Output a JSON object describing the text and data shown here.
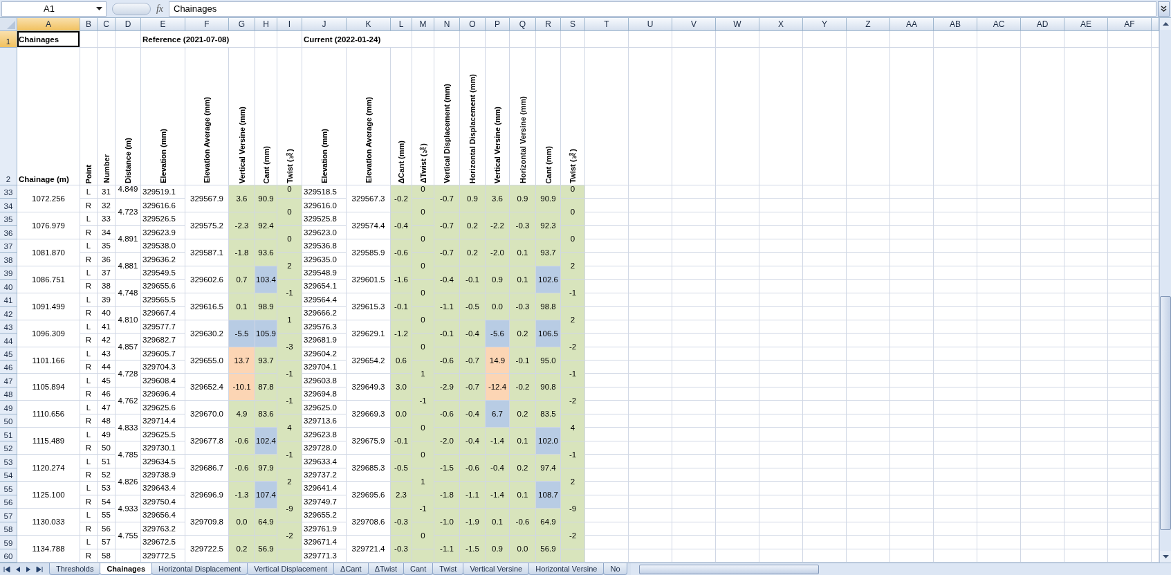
{
  "formula_bar": {
    "name_box": "A1",
    "function_label": "fx",
    "formula": "Chainages"
  },
  "columns": [
    {
      "label": "A",
      "selected": true,
      "shaded": false
    },
    {
      "label": "B",
      "selected": false,
      "shaded": false
    },
    {
      "label": "C",
      "selected": false,
      "shaded": false
    },
    {
      "label": "D",
      "selected": false,
      "shaded": false
    },
    {
      "label": "E",
      "selected": false,
      "shaded": false
    },
    {
      "label": "F",
      "selected": false,
      "shaded": false
    },
    {
      "label": "G",
      "selected": false,
      "shaded": true
    },
    {
      "label": "H",
      "selected": false,
      "shaded": true
    },
    {
      "label": "I",
      "selected": false,
      "shaded": true
    },
    {
      "label": "J",
      "selected": false,
      "shaded": false
    },
    {
      "label": "K",
      "selected": false,
      "shaded": false
    },
    {
      "label": "L",
      "selected": false,
      "shaded": true
    },
    {
      "label": "M",
      "selected": false,
      "shaded": true
    },
    {
      "label": "N",
      "selected": false,
      "shaded": true
    },
    {
      "label": "O",
      "selected": false,
      "shaded": true
    },
    {
      "label": "P",
      "selected": false,
      "shaded": true
    },
    {
      "label": "Q",
      "selected": false,
      "shaded": true
    },
    {
      "label": "R",
      "selected": false,
      "shaded": true
    },
    {
      "label": "S",
      "selected": false,
      "shaded": true
    },
    {
      "label": "T",
      "selected": false,
      "shaded": false
    },
    {
      "label": "U",
      "selected": false,
      "shaded": false
    },
    {
      "label": "V",
      "selected": false,
      "shaded": false
    },
    {
      "label": "W",
      "selected": false,
      "shaded": false
    },
    {
      "label": "X",
      "selected": false,
      "shaded": false
    },
    {
      "label": "Y",
      "selected": false,
      "shaded": false
    },
    {
      "label": "Z",
      "selected": false,
      "shaded": false
    },
    {
      "label": "AA",
      "selected": false,
      "shaded": false
    },
    {
      "label": "AB",
      "selected": false,
      "shaded": false
    },
    {
      "label": "AC",
      "selected": false,
      "shaded": false
    },
    {
      "label": "AD",
      "selected": false,
      "shaded": false
    },
    {
      "label": "AE",
      "selected": false,
      "shaded": false
    },
    {
      "label": "AF",
      "selected": false,
      "shaded": false
    }
  ],
  "rows": [
    {
      "label": "1",
      "selected": true
    },
    {
      "label": "2",
      "selected": false
    },
    {
      "label": "33",
      "selected": false
    },
    {
      "label": "34",
      "selected": false
    },
    {
      "label": "35",
      "selected": false
    },
    {
      "label": "36",
      "selected": false
    },
    {
      "label": "37",
      "selected": false
    },
    {
      "label": "38",
      "selected": false
    },
    {
      "label": "39",
      "selected": false
    },
    {
      "label": "40",
      "selected": false
    },
    {
      "label": "41",
      "selected": false
    },
    {
      "label": "42",
      "selected": false
    },
    {
      "label": "43",
      "selected": false
    },
    {
      "label": "44",
      "selected": false
    },
    {
      "label": "45",
      "selected": false
    },
    {
      "label": "46",
      "selected": false
    },
    {
      "label": "47",
      "selected": false
    },
    {
      "label": "48",
      "selected": false
    },
    {
      "label": "49",
      "selected": false
    },
    {
      "label": "50",
      "selected": false
    },
    {
      "label": "51",
      "selected": false
    },
    {
      "label": "52",
      "selected": false
    },
    {
      "label": "53",
      "selected": false
    },
    {
      "label": "54",
      "selected": false
    },
    {
      "label": "55",
      "selected": false
    },
    {
      "label": "56",
      "selected": false
    },
    {
      "label": "57",
      "selected": false
    },
    {
      "label": "58",
      "selected": false
    },
    {
      "label": "59",
      "selected": false
    },
    {
      "label": "60",
      "selected": false
    }
  ],
  "title_row": {
    "chainages": "Chainages",
    "reference": "Reference (2021-07-08)",
    "current": "Current (2022-01-24)"
  },
  "headers": [
    "Chainage (m)",
    "Point",
    "Number",
    "Distance (m)",
    "Elevation (mm)",
    "Elevation Average (mm)",
    "Vertical Versine (mm)",
    "Cant (mm)",
    "Twist (‰)",
    "Elevation (mm)",
    "Elevation Average (mm)",
    "ΔCant (mm)",
    "ΔTwist (‰)",
    "Vertical Displacement (mm)",
    "Horizontal Displacement (mm)",
    "Vertical Versine (mm)",
    "Horizontal Versine (mm)",
    "Cant (mm)",
    "Twist (‰)"
  ],
  "pairs": [
    {
      "chainage": "1072.256",
      "points": [
        {
          "side": "L",
          "number": "31",
          "ref_elevation": "329519.1",
          "cur_elevation": "329518.5"
        },
        {
          "side": "R",
          "number": "32",
          "ref_elevation": "329616.6",
          "cur_elevation": "329616.0"
        }
      ],
      "ref": {
        "average": "329567.9",
        "vertical_versine": {
          "text": "3.6"
        },
        "cant": {
          "text": "90.9"
        }
      },
      "cur": {
        "average": "329567.3",
        "delta_cant": "-0.2",
        "vertical_displacement": "-0.7",
        "horizontal_displacement": "0.9",
        "vertical_versine": {
          "text": "3.6"
        },
        "horizontal_versine": "0.9",
        "cant": {
          "text": "90.9"
        }
      }
    },
    {
      "chainage": "1076.979",
      "points": [
        {
          "side": "L",
          "number": "33",
          "ref_elevation": "329526.5",
          "cur_elevation": "329525.8"
        },
        {
          "side": "R",
          "number": "34",
          "ref_elevation": "329623.9",
          "cur_elevation": "329623.0"
        }
      ],
      "ref": {
        "average": "329575.2",
        "vertical_versine": {
          "text": "-2.3"
        },
        "cant": {
          "text": "92.4"
        }
      },
      "cur": {
        "average": "329574.4",
        "delta_cant": "-0.4",
        "vertical_displacement": "-0.7",
        "horizontal_displacement": "0.2",
        "vertical_versine": {
          "text": "-2.2"
        },
        "horizontal_versine": "-0.3",
        "cant": {
          "text": "92.3"
        }
      }
    },
    {
      "chainage": "1081.870",
      "points": [
        {
          "side": "L",
          "number": "35",
          "ref_elevation": "329538.0",
          "cur_elevation": "329536.8"
        },
        {
          "side": "R",
          "number": "36",
          "ref_elevation": "329636.2",
          "cur_elevation": "329635.0"
        }
      ],
      "ref": {
        "average": "329587.1",
        "vertical_versine": {
          "text": "-1.8"
        },
        "cant": {
          "text": "93.6"
        }
      },
      "cur": {
        "average": "329585.9",
        "delta_cant": "-0.6",
        "vertical_displacement": "-0.7",
        "horizontal_displacement": "0.2",
        "vertical_versine": {
          "text": "-2.0"
        },
        "horizontal_versine": "0.1",
        "cant": {
          "text": "93.7"
        }
      }
    },
    {
      "chainage": "1086.751",
      "points": [
        {
          "side": "L",
          "number": "37",
          "ref_elevation": "329549.5",
          "cur_elevation": "329548.9"
        },
        {
          "side": "R",
          "number": "38",
          "ref_elevation": "329655.6",
          "cur_elevation": "329654.1"
        }
      ],
      "ref": {
        "average": "329602.6",
        "vertical_versine": {
          "text": "0.7"
        },
        "cant": {
          "text": "103.4",
          "color": "#b8cce4"
        }
      },
      "cur": {
        "average": "329601.5",
        "delta_cant": "-1.6",
        "vertical_displacement": "-0.4",
        "horizontal_displacement": "-0.1",
        "vertical_versine": {
          "text": "0.9"
        },
        "horizontal_versine": "0.1",
        "cant": {
          "text": "102.6",
          "color": "#b8cce4"
        }
      }
    },
    {
      "chainage": "1091.499",
      "points": [
        {
          "side": "L",
          "number": "39",
          "ref_elevation": "329565.5",
          "cur_elevation": "329564.4"
        },
        {
          "side": "R",
          "number": "40",
          "ref_elevation": "329667.4",
          "cur_elevation": "329666.2"
        }
      ],
      "ref": {
        "average": "329616.5",
        "vertical_versine": {
          "text": "0.1"
        },
        "cant": {
          "text": "98.9"
        }
      },
      "cur": {
        "average": "329615.3",
        "delta_cant": "-0.1",
        "vertical_displacement": "-1.1",
        "horizontal_displacement": "-0.5",
        "vertical_versine": {
          "text": "0.0"
        },
        "horizontal_versine": "-0.3",
        "cant": {
          "text": "98.8"
        }
      }
    },
    {
      "chainage": "1096.309",
      "points": [
        {
          "side": "L",
          "number": "41",
          "ref_elevation": "329577.7",
          "cur_elevation": "329576.3"
        },
        {
          "side": "R",
          "number": "42",
          "ref_elevation": "329682.7",
          "cur_elevation": "329681.9"
        }
      ],
      "ref": {
        "average": "329630.2",
        "vertical_versine": {
          "text": "-5.5",
          "color": "#b8cce4"
        },
        "cant": {
          "text": "105.9",
          "color": "#b8cce4"
        }
      },
      "cur": {
        "average": "329629.1",
        "delta_cant": "-1.2",
        "vertical_displacement": "-0.1",
        "horizontal_displacement": "-0.4",
        "vertical_versine": {
          "text": "-5.6",
          "color": "#b8cce4"
        },
        "horizontal_versine": "0.2",
        "cant": {
          "text": "106.5",
          "color": "#b8cce4"
        }
      }
    },
    {
      "chainage": "1101.166",
      "points": [
        {
          "side": "L",
          "number": "43",
          "ref_elevation": "329605.7",
          "cur_elevation": "329604.2"
        },
        {
          "side": "R",
          "number": "44",
          "ref_elevation": "329704.3",
          "cur_elevation": "329704.1"
        }
      ],
      "ref": {
        "average": "329655.0",
        "vertical_versine": {
          "text": "13.7",
          "color": "#fcd5b4"
        },
        "cant": {
          "text": "93.7"
        }
      },
      "cur": {
        "average": "329654.2",
        "delta_cant": "0.6",
        "vertical_displacement": "-0.6",
        "horizontal_displacement": "-0.7",
        "vertical_versine": {
          "text": "14.9",
          "color": "#fcd5b4"
        },
        "horizontal_versine": "-0.1",
        "cant": {
          "text": "95.0"
        }
      }
    },
    {
      "chainage": "1105.894",
      "points": [
        {
          "side": "L",
          "number": "45",
          "ref_elevation": "329608.4",
          "cur_elevation": "329603.8"
        },
        {
          "side": "R",
          "number": "46",
          "ref_elevation": "329696.4",
          "cur_elevation": "329694.8"
        }
      ],
      "ref": {
        "average": "329652.4",
        "vertical_versine": {
          "text": "-10.1",
          "color": "#fcd5b4"
        },
        "cant": {
          "text": "87.8"
        }
      },
      "cur": {
        "average": "329649.3",
        "delta_cant": "3.0",
        "vertical_displacement": "-2.9",
        "horizontal_displacement": "-0.7",
        "vertical_versine": {
          "text": "-12.4",
          "color": "#fcd5b4"
        },
        "horizontal_versine": "-0.2",
        "cant": {
          "text": "90.8"
        }
      }
    },
    {
      "chainage": "1110.656",
      "points": [
        {
          "side": "L",
          "number": "47",
          "ref_elevation": "329625.6",
          "cur_elevation": "329625.0"
        },
        {
          "side": "R",
          "number": "48",
          "ref_elevation": "329714.4",
          "cur_elevation": "329713.6"
        }
      ],
      "ref": {
        "average": "329670.0",
        "vertical_versine": {
          "text": "4.9"
        },
        "cant": {
          "text": "83.6"
        }
      },
      "cur": {
        "average": "329669.3",
        "delta_cant": "0.0",
        "vertical_displacement": "-0.6",
        "horizontal_displacement": "-0.4",
        "vertical_versine": {
          "text": "6.7",
          "color": "#b8cce4"
        },
        "horizontal_versine": "0.2",
        "cant": {
          "text": "83.5"
        }
      }
    },
    {
      "chainage": "1115.489",
      "points": [
        {
          "side": "L",
          "number": "49",
          "ref_elevation": "329625.5",
          "cur_elevation": "329623.8"
        },
        {
          "side": "R",
          "number": "50",
          "ref_elevation": "329730.1",
          "cur_elevation": "329728.0"
        }
      ],
      "ref": {
        "average": "329677.8",
        "vertical_versine": {
          "text": "-0.6"
        },
        "cant": {
          "text": "102.4",
          "color": "#b8cce4"
        }
      },
      "cur": {
        "average": "329675.9",
        "delta_cant": "-0.1",
        "vertical_displacement": "-2.0",
        "horizontal_displacement": "-0.4",
        "vertical_versine": {
          "text": "-1.4"
        },
        "horizontal_versine": "0.1",
        "cant": {
          "text": "102.0",
          "color": "#b8cce4"
        }
      }
    },
    {
      "chainage": "1120.274",
      "points": [
        {
          "side": "L",
          "number": "51",
          "ref_elevation": "329634.5",
          "cur_elevation": "329633.4"
        },
        {
          "side": "R",
          "number": "52",
          "ref_elevation": "329738.9",
          "cur_elevation": "329737.2"
        }
      ],
      "ref": {
        "average": "329686.7",
        "vertical_versine": {
          "text": "-0.6"
        },
        "cant": {
          "text": "97.9"
        }
      },
      "cur": {
        "average": "329685.3",
        "delta_cant": "-0.5",
        "vertical_displacement": "-1.5",
        "horizontal_displacement": "-0.6",
        "vertical_versine": {
          "text": "-0.4"
        },
        "horizontal_versine": "0.2",
        "cant": {
          "text": "97.4"
        }
      }
    },
    {
      "chainage": "1125.100",
      "points": [
        {
          "side": "L",
          "number": "53",
          "ref_elevation": "329643.4",
          "cur_elevation": "329641.4"
        },
        {
          "side": "R",
          "number": "54",
          "ref_elevation": "329750.4",
          "cur_elevation": "329749.7"
        }
      ],
      "ref": {
        "average": "329696.9",
        "vertical_versine": {
          "text": "-1.3"
        },
        "cant": {
          "text": "107.4",
          "color": "#b8cce4"
        }
      },
      "cur": {
        "average": "329695.6",
        "delta_cant": "2.3",
        "vertical_displacement": "-1.8",
        "horizontal_displacement": "-1.1",
        "vertical_versine": {
          "text": "-1.4"
        },
        "horizontal_versine": "0.1",
        "cant": {
          "text": "108.7",
          "color": "#b8cce4"
        }
      }
    },
    {
      "chainage": "1130.033",
      "points": [
        {
          "side": "L",
          "number": "55",
          "ref_elevation": "329656.4",
          "cur_elevation": "329655.2"
        },
        {
          "side": "R",
          "number": "56",
          "ref_elevation": "329763.2",
          "cur_elevation": "329761.9"
        }
      ],
      "ref": {
        "average": "329709.8",
        "vertical_versine": {
          "text": "0.0"
        },
        "cant": {
          "text": "64.9"
        }
      },
      "cur": {
        "average": "329708.6",
        "delta_cant": "-0.3",
        "vertical_displacement": "-1.0",
        "horizontal_displacement": "-1.9",
        "vertical_versine": {
          "text": "0.1"
        },
        "horizontal_versine": "-0.6",
        "cant": {
          "text": "64.9"
        }
      }
    },
    {
      "chainage": "1134.788",
      "points": [
        {
          "side": "L",
          "number": "57",
          "ref_elevation": "329672.5",
          "cur_elevation": "329671.4"
        },
        {
          "side": "R",
          "number": "58",
          "ref_elevation": "329772.5",
          "cur_elevation": "329771.3"
        }
      ],
      "ref": {
        "average": "329722.5",
        "vertical_versine": {
          "text": "0.2"
        },
        "cant": {
          "text": "56.9"
        }
      },
      "cur": {
        "average": "329721.4",
        "delta_cant": "-0.3",
        "vertical_displacement": "-1.1",
        "horizontal_displacement": "-1.5",
        "vertical_versine": {
          "text": "0.9"
        },
        "horizontal_versine": "0.0",
        "cant": {
          "text": "56.9"
        }
      }
    }
  ],
  "offsets": [
    {
      "distance": "4.849",
      "ref_twist": "0",
      "delta_twist": "0",
      "twist": "0"
    },
    {
      "distance": "4.723",
      "ref_twist": "0",
      "delta_twist": "0",
      "twist": "0"
    },
    {
      "distance": "4.891",
      "ref_twist": "0",
      "delta_twist": "0",
      "twist": "0"
    },
    {
      "distance": "4.881",
      "ref_twist": "2",
      "delta_twist": "0",
      "twist": "2"
    },
    {
      "distance": "4.748",
      "ref_twist": "-1",
      "delta_twist": "0",
      "twist": "-1"
    },
    {
      "distance": "4.810",
      "ref_twist": "1",
      "delta_twist": "0",
      "twist": "2"
    },
    {
      "distance": "4.857",
      "ref_twist": "-3",
      "delta_twist": "0",
      "twist": "-2"
    },
    {
      "distance": "4.728",
      "ref_twist": "-1",
      "delta_twist": "1",
      "twist": "-1"
    },
    {
      "distance": "4.762",
      "ref_twist": "-1",
      "delta_twist": "-1",
      "twist": "-2"
    },
    {
      "distance": "4.833",
      "ref_twist": "4",
      "delta_twist": "0",
      "twist": "4"
    },
    {
      "distance": "4.785",
      "ref_twist": "-1",
      "delta_twist": "0",
      "twist": "-1"
    },
    {
      "distance": "4.826",
      "ref_twist": "2",
      "delta_twist": "1",
      "twist": "2"
    },
    {
      "distance": "4.933",
      "ref_twist": "-9",
      "delta_twist": "-1",
      "twist": "-9"
    },
    {
      "distance": "4.755",
      "ref_twist": "-2",
      "delta_twist": "0",
      "twist": "-2"
    }
  ],
  "sheet_tabs": [
    {
      "label": "Thresholds",
      "selected": false
    },
    {
      "label": "Chainages",
      "selected": true
    },
    {
      "label": "Horizontal Displacement",
      "selected": false
    },
    {
      "label": "Vertical Displacement",
      "selected": false
    },
    {
      "label": "ΔCant",
      "selected": false
    },
    {
      "label": "ΔTwist",
      "selected": false
    },
    {
      "label": "Cant",
      "selected": false
    },
    {
      "label": "Twist",
      "selected": false
    },
    {
      "label": "Vertical Versine",
      "selected": false
    },
    {
      "label": "Horizontal Versine",
      "selected": false
    },
    {
      "label": "No",
      "selected": false
    }
  ]
}
